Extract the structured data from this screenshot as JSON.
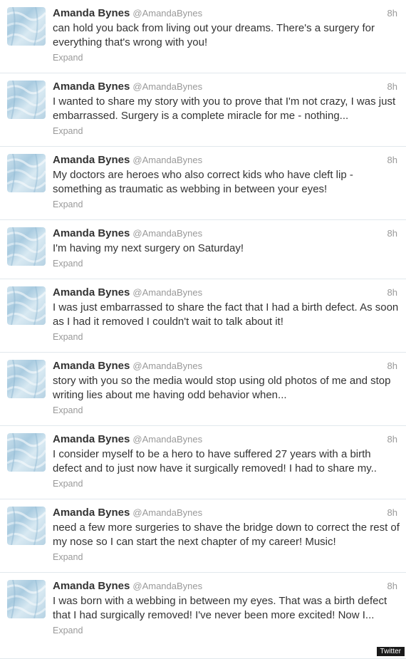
{
  "tweets": [
    {
      "name": "Amanda Bynes",
      "handle": "@AmandaBynes",
      "time": "8h",
      "text": "can hold you back from living out your dreams. There's a surgery for everything that's wrong with you!",
      "expand": "Expand"
    },
    {
      "name": "Amanda Bynes",
      "handle": "@AmandaBynes",
      "time": "8h",
      "text": "I wanted to share my story with you to prove that I'm not crazy, I was just embarrassed. Surgery is a complete miracle for me - nothing...",
      "expand": "Expand"
    },
    {
      "name": "Amanda Bynes",
      "handle": "@AmandaBynes",
      "time": "8h",
      "text": "My doctors are heroes who also correct kids who have cleft lip - something as traumatic as webbing in between your eyes!",
      "expand": "Expand"
    },
    {
      "name": "Amanda Bynes",
      "handle": "@AmandaBynes",
      "time": "8h",
      "text": "I'm having my next surgery on Saturday!",
      "expand": "Expand"
    },
    {
      "name": "Amanda Bynes",
      "handle": "@AmandaBynes",
      "time": "8h",
      "text": "I was just embarrassed to share the fact that I had a birth defect. As soon as I had it removed I couldn't wait to talk about it!",
      "expand": "Expand"
    },
    {
      "name": "Amanda Bynes",
      "handle": "@AmandaBynes",
      "time": "8h",
      "text": "story with you so the media would stop using old photos of me and stop writing lies about me having odd behavior when...",
      "expand": "Expand"
    },
    {
      "name": "Amanda Bynes",
      "handle": "@AmandaBynes",
      "time": "8h",
      "text": "I consider myself to be a hero to have suffered 27 years with a birth defect and to just now have it surgically removed! I had to share my..",
      "expand": "Expand"
    },
    {
      "name": "Amanda Bynes",
      "handle": "@AmandaBynes",
      "time": "8h",
      "text": "need a few more surgeries to shave the bridge down to correct the rest of my nose so I can start the next chapter of my career! Music!",
      "expand": "Expand"
    },
    {
      "name": "Amanda Bynes",
      "handle": "@AmandaBynes",
      "time": "8h",
      "text": "I was born with a webbing in between my eyes. That was a birth defect that I had surgically removed! I've never been more excited! Now I...",
      "expand": "Expand"
    }
  ],
  "credit": "Twitter"
}
